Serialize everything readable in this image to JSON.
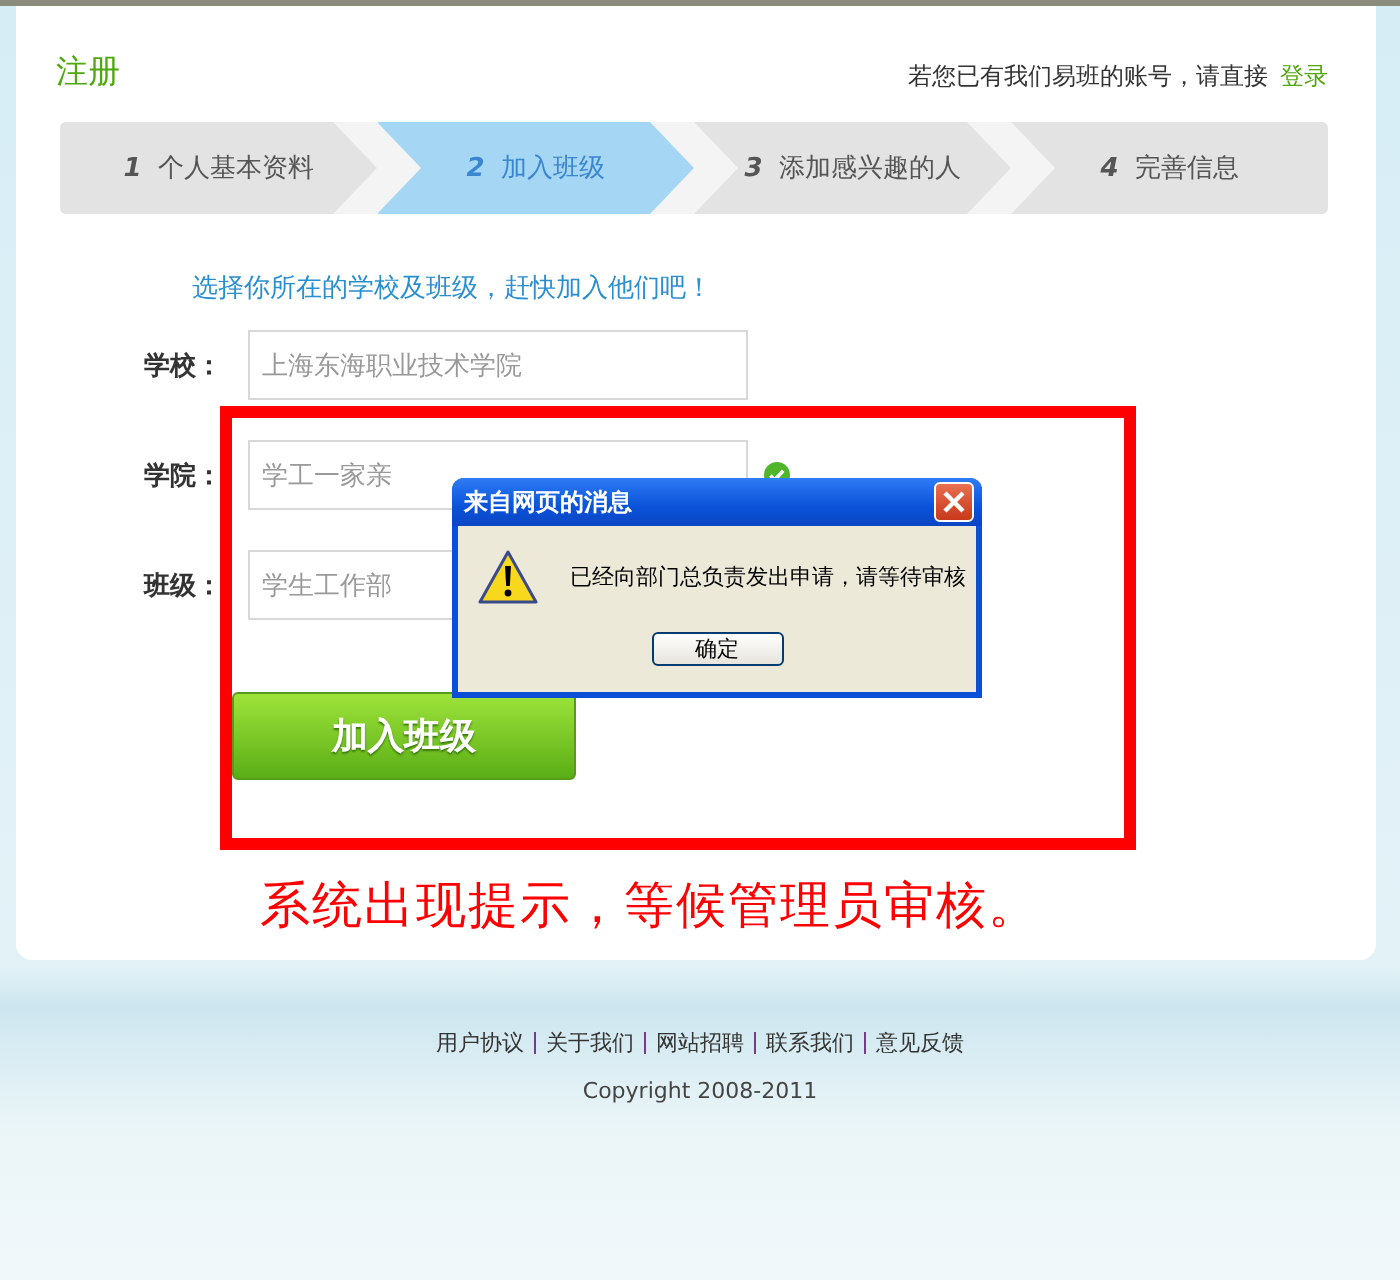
{
  "header": {
    "title": "注册",
    "login_prompt": "若您已有我们易班的账号，请直接",
    "login_link": "登录"
  },
  "steps": [
    {
      "number": "1",
      "label": "个人基本资料",
      "selected": false
    },
    {
      "number": "2",
      "label": "加入班级",
      "selected": true
    },
    {
      "number": "3",
      "label": "添加感兴趣的人",
      "selected": false
    },
    {
      "number": "4",
      "label": "完善信息",
      "selected": false
    }
  ],
  "form": {
    "intro": "选择你所在的学校及班级，赶快加入他们吧！",
    "fields": [
      {
        "label": "学校：",
        "value": "上海东海职业技术学院",
        "valid": false
      },
      {
        "label": "学院：",
        "value": "学工一家亲",
        "valid": true
      },
      {
        "label": "班级：",
        "value": "学生工作部",
        "valid": false
      }
    ],
    "submit": "加入班级"
  },
  "dialog": {
    "title": "来自网页的消息",
    "message": "已经向部门总负责发出申请，请等待审核",
    "ok": "确定"
  },
  "annotation": "系统出现提示，等候管理员审核。",
  "footer": {
    "links": [
      "用户协议",
      "关于我们",
      "网站招聘",
      "联系我们",
      "意见反馈"
    ],
    "copyright": "Copyright 2008-2011"
  }
}
